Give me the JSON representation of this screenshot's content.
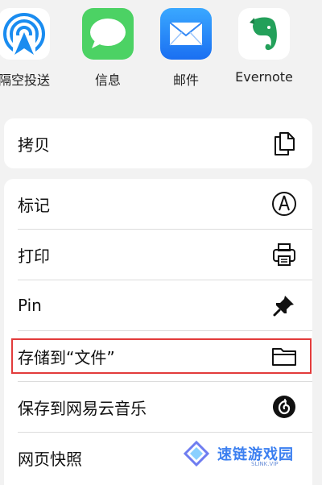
{
  "share_apps": [
    {
      "name": "airdrop",
      "label": "隔空投送"
    },
    {
      "name": "messages",
      "label": "信息"
    },
    {
      "name": "mail",
      "label": "邮件"
    },
    {
      "name": "evernote",
      "label": "Evernote"
    }
  ],
  "actions_top": [
    {
      "label": "拷贝",
      "icon": "copy-icon"
    }
  ],
  "actions": [
    {
      "label": "标记",
      "icon": "markup-icon"
    },
    {
      "label": "打印",
      "icon": "print-icon"
    },
    {
      "label": "Pin",
      "icon": "pin-icon"
    },
    {
      "label": "存储到“文件”",
      "icon": "folder-icon"
    },
    {
      "label": "保存到网易云音乐",
      "icon": "netease-music-icon"
    },
    {
      "label": "网页快照",
      "icon": "snapshot-icon"
    }
  ],
  "highlight_color": "#e23b3b",
  "watermark": {
    "text": "速链游戏园",
    "sub": "SLINK.VIP"
  }
}
